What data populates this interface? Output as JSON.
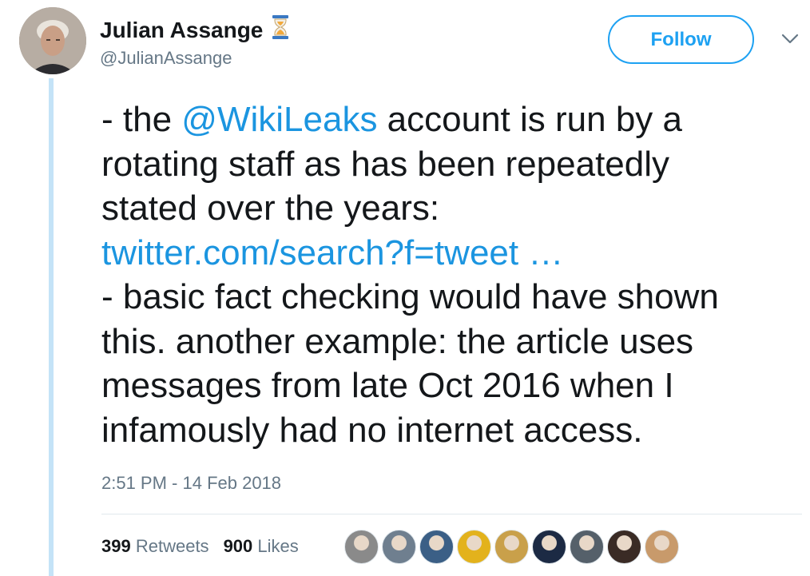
{
  "author": {
    "name": "Julian Assange",
    "handle": "@JulianAssange",
    "badge_icon": "hourglass-icon"
  },
  "actions": {
    "follow_label": "Follow",
    "menu_icon": "chevron-down-icon"
  },
  "tweet": {
    "line1_before": "- the ",
    "mention": "@WikiLeaks",
    "line1_after": " account is run by a",
    "line2": "rotating staff as has been repeatedly",
    "line3": "stated over the years:",
    "link": "twitter.com/search?f=tweet  …",
    "line5": "- basic fact checking would have shown",
    "line6": "this. another example: the article uses",
    "line7": "messages from late Oct 2016 when I",
    "line8": "infamously had no internet access."
  },
  "timestamp": "2:51 PM - 14 Feb 2018",
  "stats": {
    "retweets_count": "399",
    "retweets_label": "Retweets",
    "likes_count": "900",
    "likes_label": "Likes"
  },
  "likers": [
    {
      "color": "#8a8a8a"
    },
    {
      "color": "#6f7f8f"
    },
    {
      "color": "#3b5f86"
    },
    {
      "color": "#e3b21c"
    },
    {
      "color": "#c9a04a"
    },
    {
      "color": "#1c2a44"
    },
    {
      "color": "#55606a"
    },
    {
      "color": "#3a2b25"
    },
    {
      "color": "#c89a6b"
    }
  ],
  "colors": {
    "accent": "#1da1f2",
    "link": "#1b95e0",
    "muted": "#657786",
    "thread": "#c4e3f7"
  }
}
